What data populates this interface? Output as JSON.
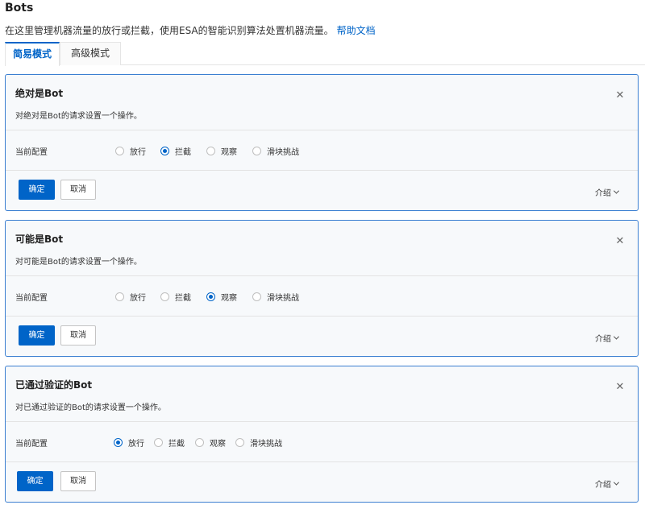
{
  "header": {
    "title": "Bots",
    "description": "在这里管理机器流量的放行或拦截，使用ESA的智能识别算法处置机器流量。",
    "help_link": "帮助文档"
  },
  "tabs": [
    {
      "label": "简易模式",
      "active": true
    },
    {
      "label": "高级模式",
      "active": false
    }
  ],
  "accent_color": "#0064c8",
  "common": {
    "config_label": "当前配置",
    "options": [
      "放行",
      "拦截",
      "观察",
      "滑块挑战"
    ],
    "confirm_label": "确定",
    "cancel_label": "取消",
    "intro_label": "介绍",
    "close_icon": "close-icon"
  },
  "cards": [
    {
      "title": "绝对是Bot",
      "description": "对绝对是Bot的请求设置一个操作。",
      "selected": "拦截"
    },
    {
      "title": "可能是Bot",
      "description": "对可能是Bot的请求设置一个操作。",
      "selected": "观察"
    },
    {
      "title": "已通过验证的Bot",
      "description": "对已通过验证的Bot的请求设置一个操作。",
      "selected": "放行"
    }
  ]
}
